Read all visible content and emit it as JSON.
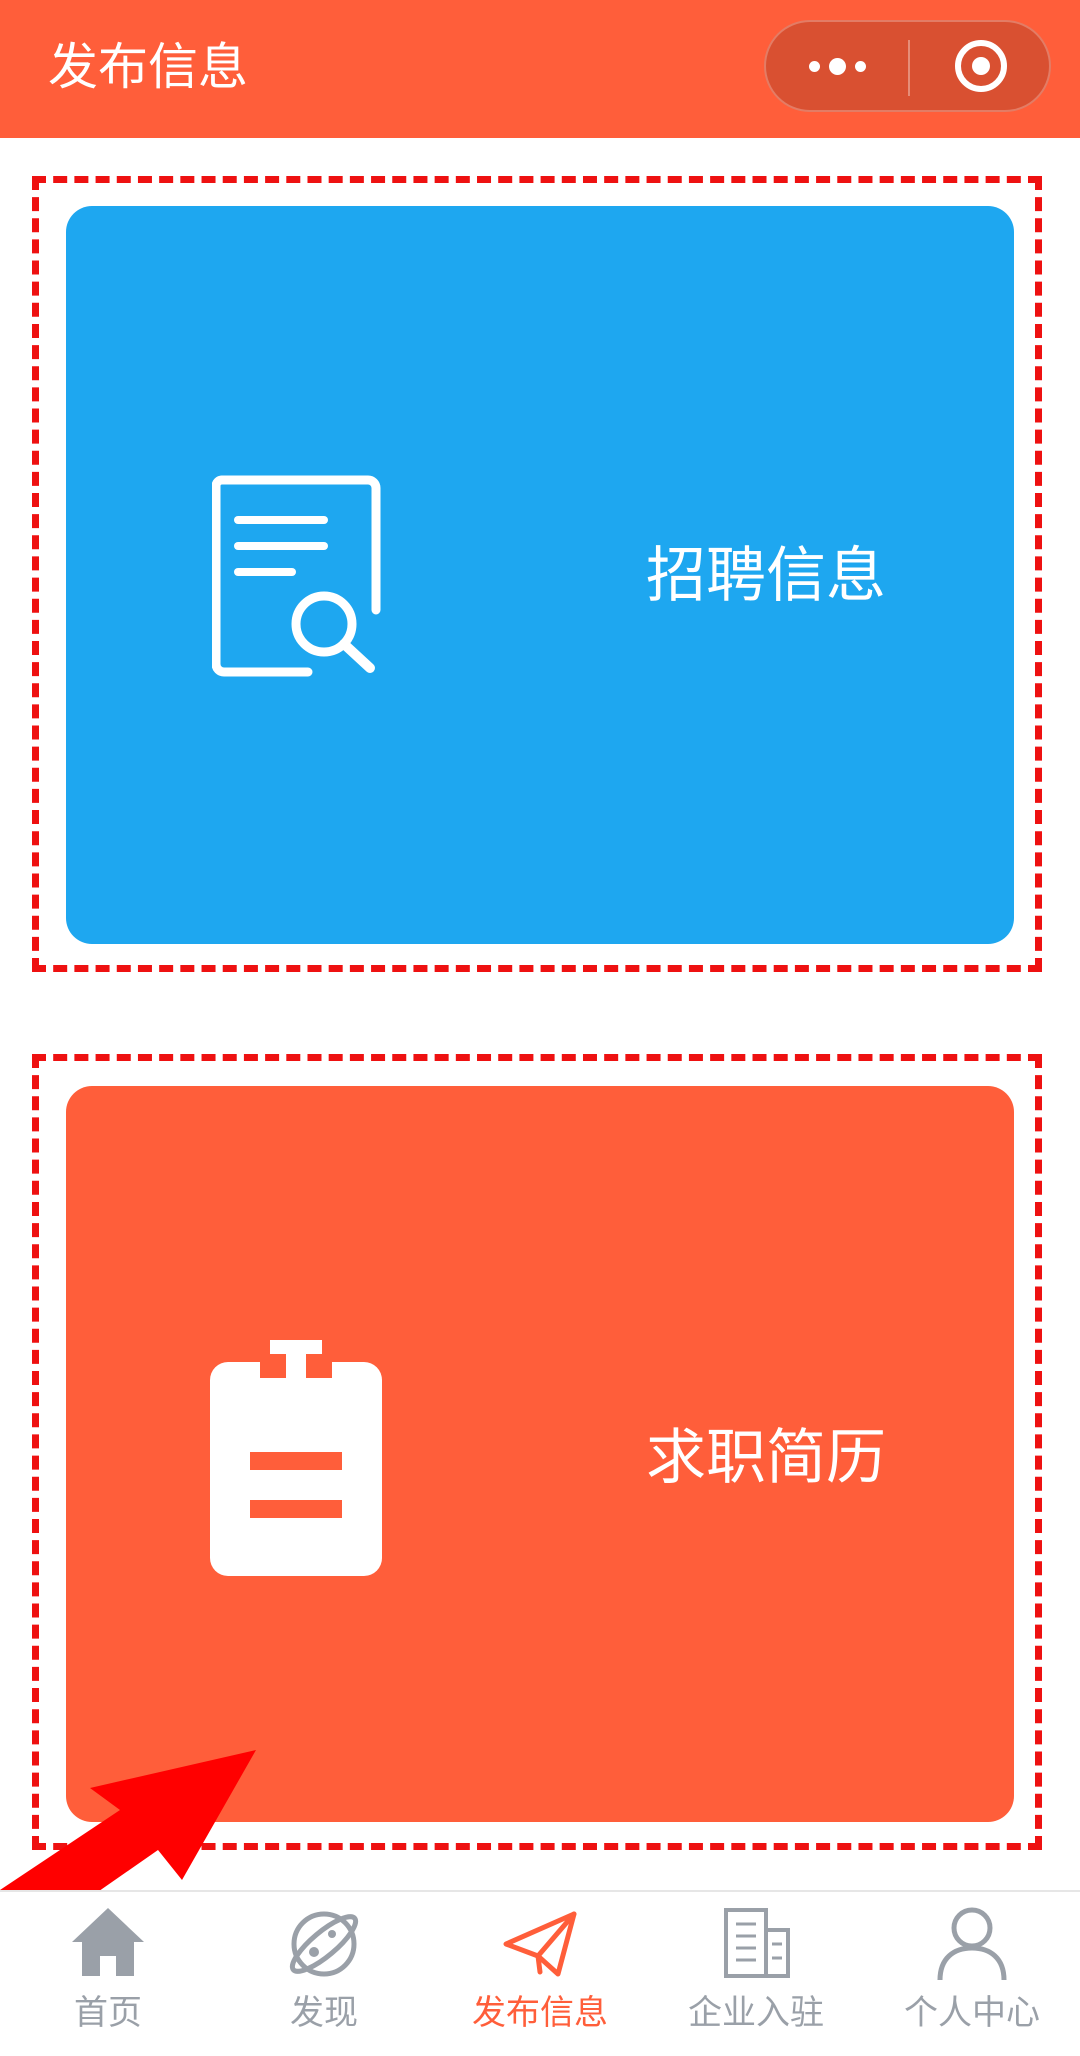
{
  "header": {
    "title": "发布信息",
    "more_icon": "more-dots-icon",
    "close_icon": "target-close-icon",
    "background": "#ff5e3a"
  },
  "cards": [
    {
      "label": "招聘信息",
      "icon": "document-search-icon",
      "color": "#1ea7f0"
    },
    {
      "label": "求职简历",
      "icon": "clipboard-icon",
      "color": "#ff5e3a"
    }
  ],
  "annotation": {
    "frame_color": "#ee1111",
    "arrow_icon": "red-arrow-icon"
  },
  "tabbar": {
    "active_color": "#ff5e3a",
    "inactive_color": "#9aa0a8",
    "items": [
      {
        "label": "首页",
        "icon": "home-icon",
        "active": false
      },
      {
        "label": "发现",
        "icon": "planet-icon",
        "active": false
      },
      {
        "label": "发布信息",
        "icon": "paper-plane-icon",
        "active": true
      },
      {
        "label": "企业入驻",
        "icon": "building-icon",
        "active": false
      },
      {
        "label": "个人中心",
        "icon": "user-icon",
        "active": false
      }
    ]
  }
}
